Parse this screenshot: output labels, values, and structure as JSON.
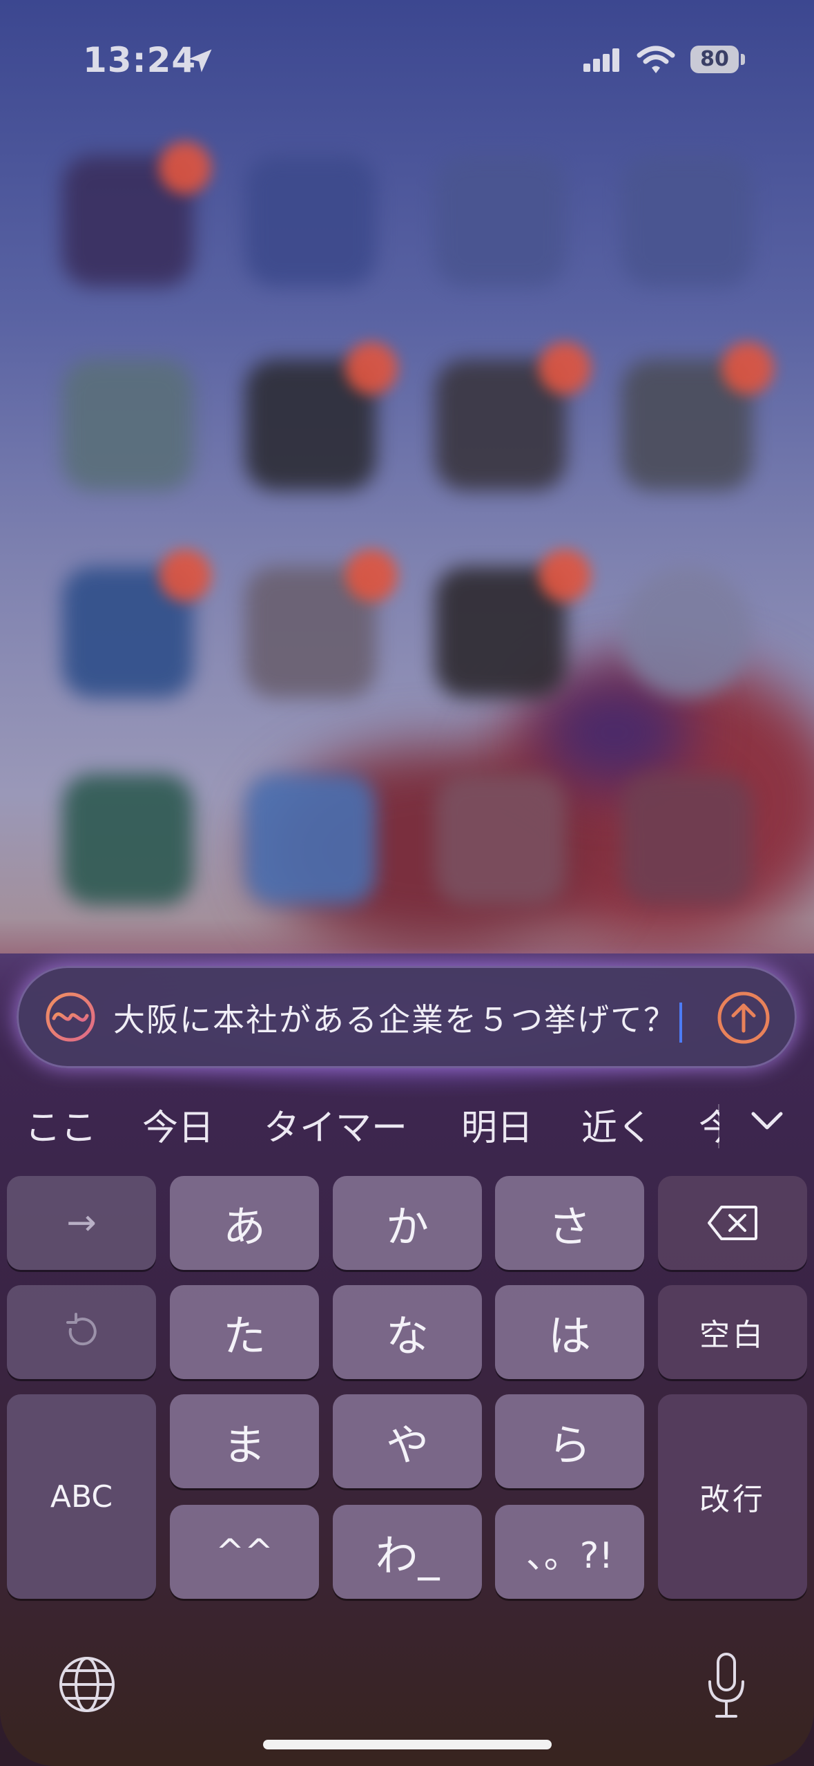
{
  "status_bar": {
    "time": "13:24",
    "battery": "80"
  },
  "siri_input": {
    "text": "大阪に本社がある企業を５つ挙げて？",
    "accent_color": "#e9825a",
    "glow_color": "#b07cff"
  },
  "suggestions": [
    "ここ",
    "今日",
    "タイマー",
    "明日",
    "近く",
    "今"
  ],
  "keyboard": {
    "row1": {
      "left": "→",
      "keys": [
        "あ",
        "か",
        "さ"
      ]
    },
    "row2": {
      "keys": [
        "た",
        "な",
        "は"
      ],
      "right": "空白"
    },
    "row3": {
      "keys": [
        "ま",
        "や",
        "ら"
      ]
    },
    "row4": {
      "keys": [
        "^^",
        "わ_",
        "、。?!"
      ]
    },
    "abc": "ABC",
    "return": "改行"
  }
}
